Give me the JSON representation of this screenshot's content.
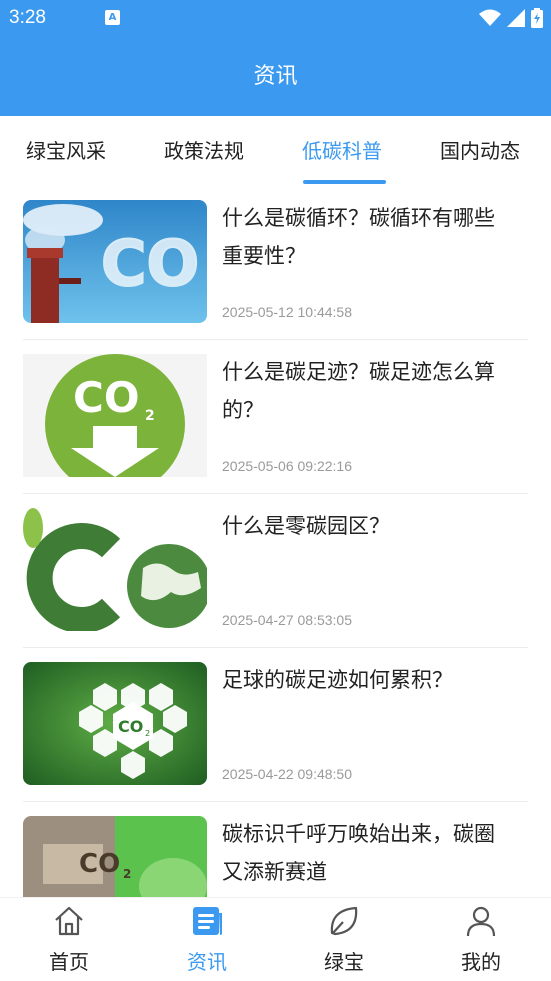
{
  "status_bar": {
    "time": "3:28",
    "notification_icon": "a-icon",
    "icons": [
      "wifi-icon",
      "signal-icon",
      "battery-icon"
    ]
  },
  "header": {
    "title": "资讯"
  },
  "tabs": [
    {
      "label": "绿宝风采",
      "active": false
    },
    {
      "label": "政策法规",
      "active": false
    },
    {
      "label": "低碳科普",
      "active": true
    },
    {
      "label": "国内动态",
      "active": false
    }
  ],
  "articles": [
    {
      "title": "什么是碳循环？碳循环有哪些重要性？",
      "date": "2025-05-12 10:44:58"
    },
    {
      "title": "什么是碳足迹？碳足迹怎么算的？",
      "date": "2025-05-06 09:22:16"
    },
    {
      "title": "什么是零碳园区？",
      "date": "2025-04-27 08:53:05"
    },
    {
      "title": "足球的碳足迹如何累积？",
      "date": "2025-04-22 09:48:50"
    },
    {
      "title": "碳标识千呼万唤始出来，碳圈又添新赛道",
      "date": ""
    }
  ],
  "bottom_nav": [
    {
      "label": "首页",
      "icon": "home-icon",
      "active": false
    },
    {
      "label": "资讯",
      "icon": "news-icon",
      "active": true
    },
    {
      "label": "绿宝",
      "icon": "leaf-icon",
      "active": false
    },
    {
      "label": "我的",
      "icon": "user-icon",
      "active": false
    }
  ],
  "colors": {
    "primary": "#3b9af0",
    "text": "#222222",
    "date": "#9a9a9a"
  }
}
